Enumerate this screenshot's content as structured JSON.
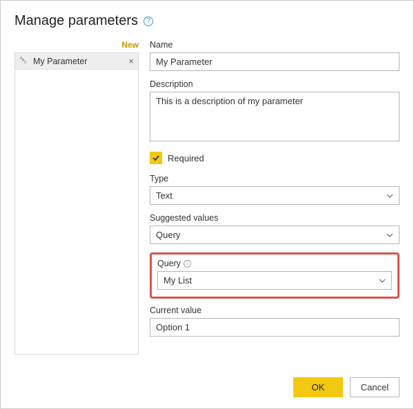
{
  "dialog": {
    "title": "Manage parameters",
    "new_label": "New"
  },
  "sidebar": {
    "items": [
      {
        "label": "My Parameter"
      }
    ]
  },
  "form": {
    "name": {
      "label": "Name",
      "value": "My Parameter"
    },
    "description": {
      "label": "Description",
      "value": "This is a description of my parameter"
    },
    "required": {
      "label": "Required",
      "checked": true
    },
    "type": {
      "label": "Type",
      "value": "Text"
    },
    "suggested": {
      "label": "Suggested values",
      "value": "Query"
    },
    "query": {
      "label": "Query",
      "value": "My List"
    },
    "current": {
      "label": "Current value",
      "value": "Option 1"
    }
  },
  "footer": {
    "ok": "OK",
    "cancel": "Cancel"
  }
}
